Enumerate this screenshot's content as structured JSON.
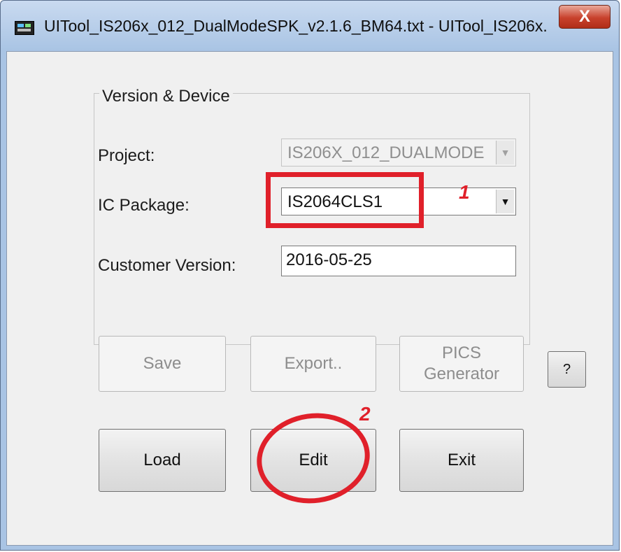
{
  "window": {
    "title": "UITool_IS206x_012_DualModeSPK_v2.1.6_BM64.txt - UITool_IS206x...",
    "close_glyph": "X"
  },
  "group": {
    "title": "Version & Device"
  },
  "fields": {
    "project_label": "Project:",
    "project_value": "IS206X_012_DUALMODE",
    "ic_package_label": "IC Package:",
    "ic_package_value": "IS2064CLS1",
    "customer_version_label": "Customer Version:",
    "customer_version_value": "2016-05-25"
  },
  "buttons": {
    "save": "Save",
    "export": "Export..",
    "pics_line1": "PICS",
    "pics_line2": "Generator",
    "help": "?",
    "load": "Load",
    "edit": "Edit",
    "exit": "Exit"
  },
  "annotations": {
    "step1": "1",
    "step2": "2",
    "color": "#e0202a"
  }
}
